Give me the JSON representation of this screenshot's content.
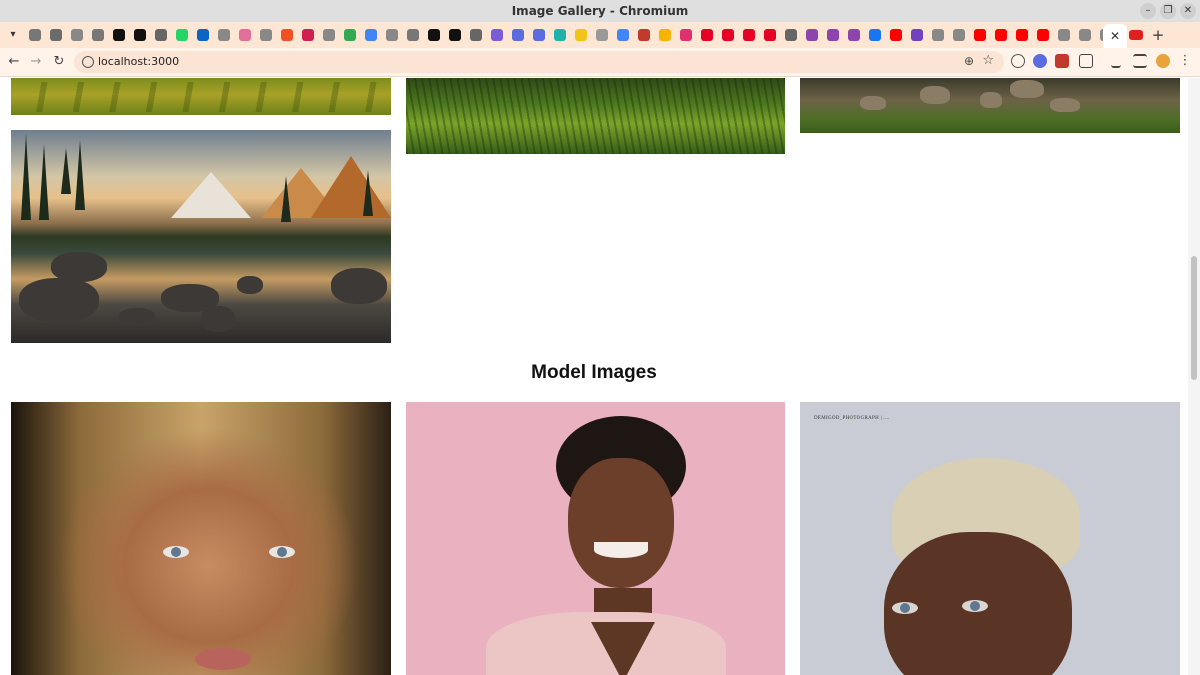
{
  "window": {
    "title": "Image Gallery - Chromium"
  },
  "tabs": {
    "favicon_colors": [
      "#777",
      "#6b6b6b",
      "#888",
      "#777",
      "#111",
      "#111",
      "#666",
      "#25d366",
      "#0a66c2",
      "#888",
      "#e0709a",
      "#888",
      "#f25022",
      "#d02050",
      "#888",
      "#34a853",
      "#4285f4",
      "#888",
      "#777",
      "#111",
      "#111",
      "#666",
      "#7b5cd6",
      "#5b6be0",
      "#5b6be0",
      "#20b2aa",
      "#f0c419",
      "#999",
      "#4285f4",
      "#c0392b",
      "#f4b400",
      "#e03070",
      "#e60023",
      "#e60023",
      "#e60023",
      "#e60023",
      "#666",
      "#8e44ad",
      "#8e44ad",
      "#8e44ad",
      "#1877f2",
      "#ff0000",
      "#6f42c1",
      "#888",
      "#888",
      "#ff0000",
      "#ff0000",
      "#ff0000",
      "#ff0000",
      "#888",
      "#888",
      "#888"
    ],
    "active_close_glyph": "✕",
    "new_tab_glyph": "+"
  },
  "toolbar": {
    "url": "localhost:3000",
    "back_glyph": "←",
    "forward_glyph": "→",
    "reload_glyph": "↻",
    "zoom_glyph": "⊕",
    "star_glyph": "☆"
  },
  "page": {
    "section_heading": "Model Images",
    "watermark": "DEMIGOD_PHOTOGRAPH | ...."
  }
}
